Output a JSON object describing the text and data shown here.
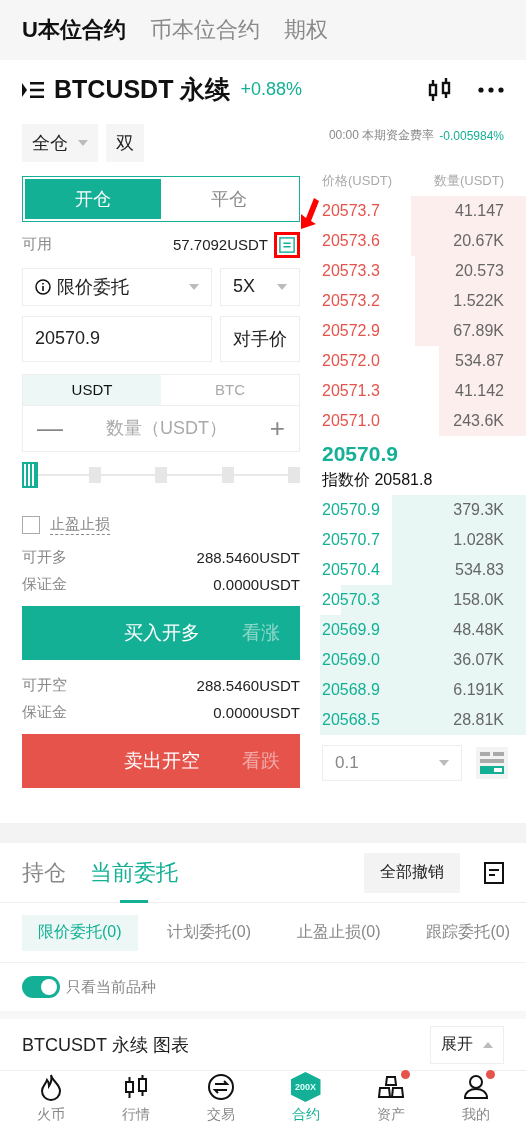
{
  "top_tabs": [
    {
      "label": "U本位合约",
      "selected": true
    },
    {
      "label": "币本位合约",
      "selected": false
    },
    {
      "label": "期权",
      "selected": false
    }
  ],
  "symbol": {
    "name": "BTCUSDT 永续",
    "change": "+0.88%"
  },
  "margin": {
    "mode": "全仓",
    "side": "双"
  },
  "funding": {
    "time": "00:00",
    "label": "本期资金费率",
    "rate": "-0.005984%"
  },
  "trade": {
    "tabs": [
      {
        "label": "开仓",
        "selected": true
      },
      {
        "label": "平仓",
        "selected": false
      }
    ],
    "available_label": "可用",
    "available": "57.7092USDT",
    "order_type": "限价委托",
    "leverage": "5X",
    "price": "20570.9",
    "counter_price": "对手价",
    "units": [
      {
        "label": "USDT",
        "selected": true
      },
      {
        "label": "BTC",
        "selected": false
      }
    ],
    "qty_placeholder": "数量（USDT）",
    "minus": "—",
    "plus": "+",
    "slider": {
      "level": 0
    },
    "tpsl": {
      "label": "止盈止损",
      "checked": false
    },
    "long_rows": [
      {
        "label": "可开多",
        "value": "288.5460USDT"
      },
      {
        "label": "保证金",
        "value": "0.0000USDT"
      }
    ],
    "buy": {
      "label": "买入开多",
      "hint": "看涨"
    },
    "short_rows": [
      {
        "label": "可开空",
        "value": "288.5460USDT"
      },
      {
        "label": "保证金",
        "value": "0.0000USDT"
      }
    ],
    "sell": {
      "label": "卖出开空",
      "hint": "看跌"
    }
  },
  "orderbook": {
    "columns": [
      "价格(USDT)",
      "数量(USDT)"
    ],
    "asks": [
      {
        "price": "20573.7",
        "qty": "41.147"
      },
      {
        "price": "20573.6",
        "qty": "20.67K"
      },
      {
        "price": "20573.3",
        "qty": "20.573"
      },
      {
        "price": "20573.2",
        "qty": "1.522K"
      },
      {
        "price": "20572.9",
        "qty": "67.89K"
      },
      {
        "price": "20572.0",
        "qty": "534.87"
      },
      {
        "price": "20571.3",
        "qty": "41.142"
      },
      {
        "price": "20571.0",
        "qty": "243.6K"
      }
    ],
    "last_price": "20570.9",
    "index_label": "指数价",
    "index_price": "20581.8",
    "bids": [
      {
        "price": "20570.9",
        "qty": "379.3K"
      },
      {
        "price": "20570.7",
        "qty": "1.028K"
      },
      {
        "price": "20570.4",
        "qty": "534.83"
      },
      {
        "price": "20570.3",
        "qty": "158.0K"
      },
      {
        "price": "20569.9",
        "qty": "48.48K"
      },
      {
        "price": "20569.0",
        "qty": "36.07K"
      },
      {
        "price": "20568.9",
        "qty": "6.191K"
      },
      {
        "price": "20568.5",
        "qty": "28.81K"
      }
    ],
    "precision": "0.1"
  },
  "orders": {
    "tabs": [
      {
        "label": "持仓",
        "selected": false
      },
      {
        "label": "当前委托",
        "selected": true
      }
    ],
    "cancel_all": "全部撤销",
    "subtabs": [
      {
        "label": "限价委托(0)",
        "selected": true
      },
      {
        "label": "计划委托(0)",
        "selected": false
      },
      {
        "label": "止盈止损(0)",
        "selected": false
      },
      {
        "label": "跟踪委托(0)",
        "selected": false
      }
    ],
    "current_only": {
      "label": "只看当前品种",
      "on": true
    }
  },
  "chart_bar": {
    "title": "BTCUSDT 永续 图表",
    "expand": "展开"
  },
  "nav": [
    {
      "label": "火币",
      "kind": "flame",
      "selected": false,
      "dot": false
    },
    {
      "label": "行情",
      "kind": "candles",
      "selected": false,
      "dot": false
    },
    {
      "label": "交易",
      "kind": "swap",
      "selected": false,
      "dot": false
    },
    {
      "label": "合约",
      "kind": "badge",
      "badge": "200X",
      "selected": true,
      "dot": false
    },
    {
      "label": "资产",
      "kind": "bars",
      "selected": false,
      "dot": true
    },
    {
      "label": "我的",
      "kind": "user",
      "selected": false,
      "dot": true
    }
  ]
}
